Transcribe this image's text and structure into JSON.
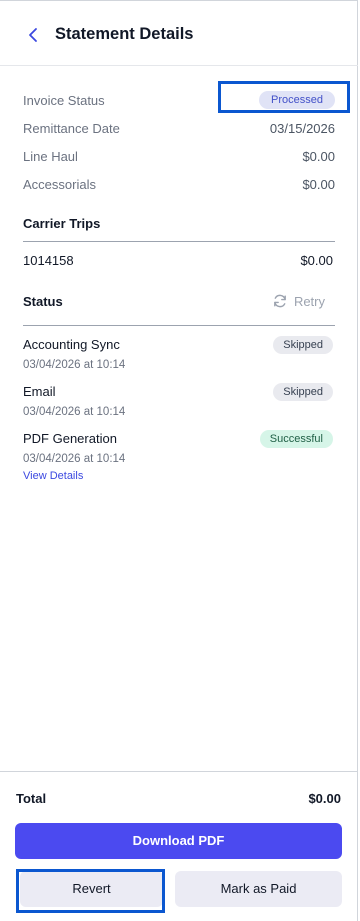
{
  "header": {
    "title": "Statement Details",
    "back_icon": "chevron-left-icon"
  },
  "summary": {
    "invoice_status_label": "Invoice Status",
    "invoice_status_value": "Processed",
    "remittance_date_label": "Remittance Date",
    "remittance_date_value": "03/15/2026",
    "line_haul_label": "Line Haul",
    "line_haul_value": "$0.00",
    "accessorials_label": "Accessorials",
    "accessorials_value": "$0.00"
  },
  "carrier_trips": {
    "title": "Carrier Trips",
    "trips": [
      {
        "id": "1014158",
        "amount": "$0.00"
      }
    ]
  },
  "status": {
    "title": "Status",
    "retry_label": "Retry",
    "retry_icon": "refresh-icon",
    "items": [
      {
        "name": "Accounting Sync",
        "time": "03/04/2026 at 10:14",
        "badge": "Skipped"
      },
      {
        "name": "Email",
        "time": "03/04/2026 at 10:14",
        "badge": "Skipped"
      },
      {
        "name": "PDF Generation",
        "time": "03/04/2026 at 10:14",
        "badge": "Successful",
        "link": "View Details"
      }
    ]
  },
  "footer": {
    "total_label": "Total",
    "total_value": "$0.00",
    "download_label": "Download PDF",
    "revert_label": "Revert",
    "mark_paid_label": "Mark as Paid"
  },
  "colors": {
    "accent": "#4b4af0",
    "highlight": "#0b57d0",
    "success_bg": "#d6f5e8",
    "skipped_bg": "#e9eaef"
  }
}
